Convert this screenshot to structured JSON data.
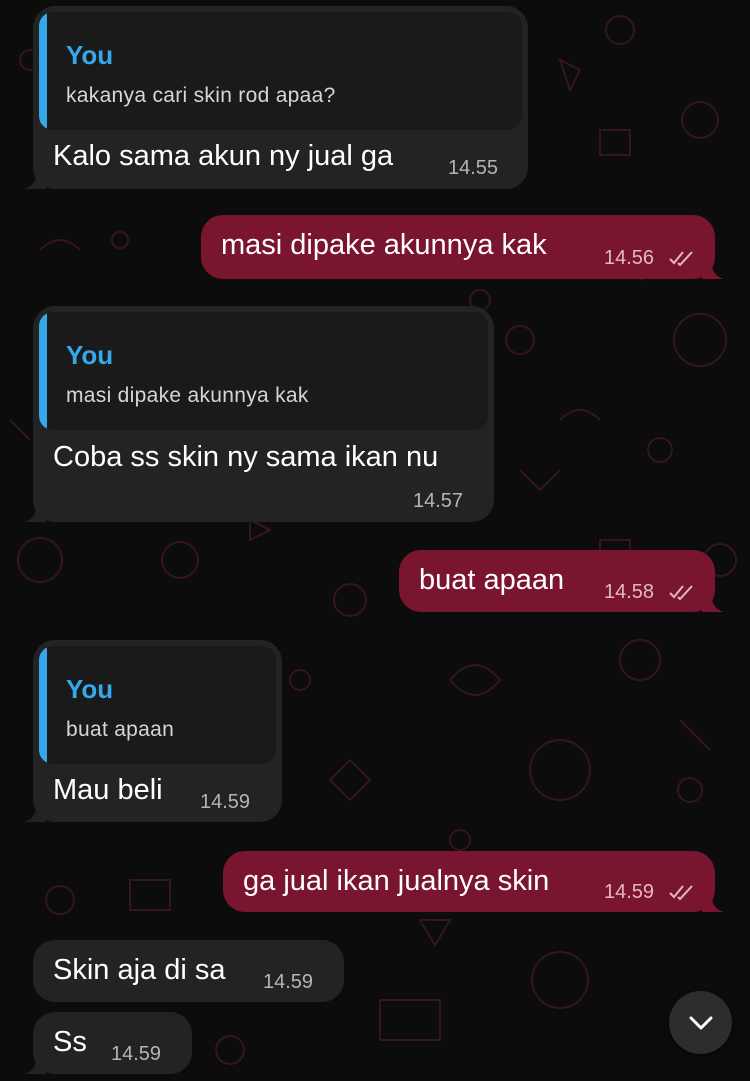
{
  "colors": {
    "background": "#0c0c0c",
    "incoming_bubble": "#232323",
    "outgoing_bubble": "#7a1530",
    "reply_accent": "#35a8ea",
    "timestamp": "#b4b4b4"
  },
  "messages": [
    {
      "direction": "incoming",
      "reply": {
        "author": "You",
        "text": "kakanya cari skin rod apaa?"
      },
      "text": "Kalo sama akun ny jual ga",
      "time": "14.55"
    },
    {
      "direction": "outgoing",
      "text": "masi dipake akunnya kak",
      "time": "14.56",
      "status": "read"
    },
    {
      "direction": "incoming",
      "reply": {
        "author": "You",
        "text": "masi dipake akunnya kak"
      },
      "text": "Coba ss skin ny sama ikan nu",
      "time": "14.57"
    },
    {
      "direction": "outgoing",
      "text": "buat apaan",
      "time": "14.58",
      "status": "read"
    },
    {
      "direction": "incoming",
      "reply": {
        "author": "You",
        "text": "buat apaan"
      },
      "text": "Mau beli",
      "time": "14.59"
    },
    {
      "direction": "outgoing",
      "text": "ga jual ikan jualnya skin",
      "time": "14.59",
      "status": "read"
    },
    {
      "direction": "incoming",
      "text": "Skin aja di sa",
      "time": "14.59"
    },
    {
      "direction": "incoming",
      "text": "Ss",
      "time": "14.59"
    }
  ],
  "scroll_button": {
    "icon": "chevron-down-icon"
  }
}
